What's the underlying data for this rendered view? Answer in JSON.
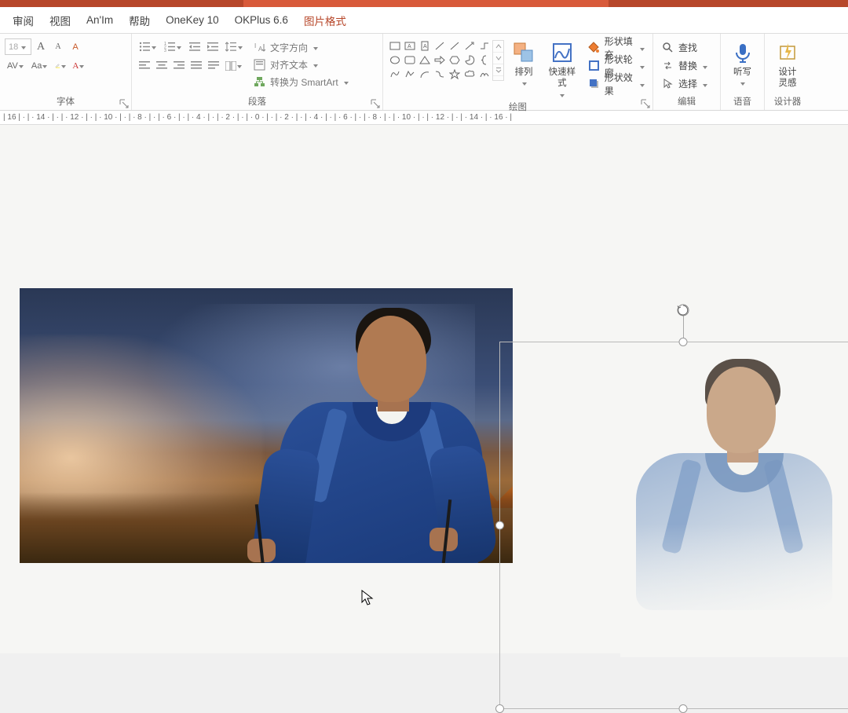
{
  "menu": {
    "review": "审阅",
    "view": "视图",
    "anim": "An'Im",
    "help": "帮助",
    "onekey": "OneKey 10",
    "okplus": "OKPlus 6.6",
    "picfmt": "图片格式"
  },
  "ribbon": {
    "font": {
      "label": "字体",
      "size": "18",
      "increaseA": "A",
      "decreaseA": "A",
      "clear": "A",
      "av": "AV",
      "aa": "Aa"
    },
    "paragraph": {
      "label": "段落",
      "textdir": "文字方向",
      "align": "对齐文本",
      "smartart": "转换为 SmartArt"
    },
    "drawing": {
      "label": "绘图",
      "arrange": "排列",
      "quickstyle": "快速样式",
      "fill": "形状填充",
      "outline": "形状轮廓",
      "effects": "形状效果"
    },
    "editing": {
      "label": "编辑",
      "find": "查找",
      "replace": "替换",
      "select": "选择"
    },
    "voice": {
      "label": "语音",
      "dictate": "听写"
    },
    "designer": {
      "label": "设计器",
      "ideas": "设计\n灵感"
    }
  },
  "ruler": "| 16 | · | · 14 · | · | · 12 · | · | · 10 · | · | · 8 · | · | · 6 · | · | · 4 · | · | · 2 · | · | · 0 · | · | · 2 · | · | · 4 · | · | · 6 · | · | · 8 · | · | · 10 · | · | · 12 · | · | · 14 · | · 16 · |",
  "colors": {
    "accent": "#b7472a",
    "shape_fill": "#ed7d31",
    "shape_outline": "#4472c4"
  }
}
